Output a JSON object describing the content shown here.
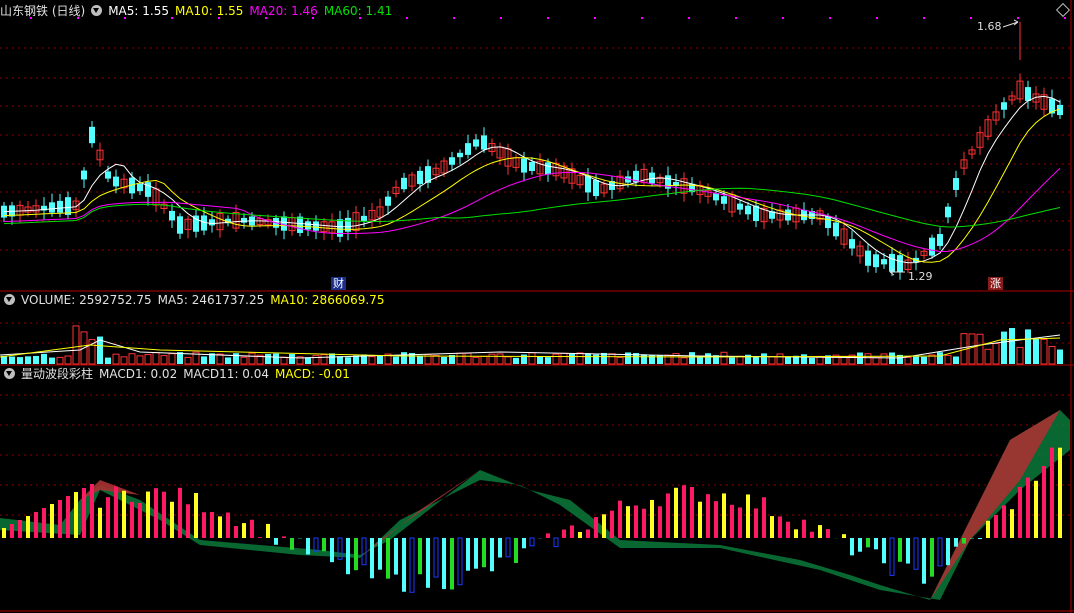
{
  "title": "山东钢铁 (日线)",
  "ma": {
    "ma5": "MA5: 1.55",
    "ma10": "MA10: 1.55",
    "ma20": "MA20: 1.46",
    "ma60": "MA60: 1.41"
  },
  "high_label": "1.68",
  "low_label": "1.29",
  "event_tags": {
    "cai": "财",
    "zhang": "涨"
  },
  "volume": {
    "volume": "VOLUME: 2592752.75",
    "ma5": "MA5: 2461737.25",
    "ma10": "MA10: 2866069.75"
  },
  "indicator": {
    "name": "量动波段彩柱",
    "macd1": "MACD1: 0.02",
    "macd11": "MACD11: 0.04",
    "macd": "MACD: -0.01"
  },
  "colors": {
    "up": "#ff3232",
    "down": "#54ffff",
    "ma5": "#ffffff",
    "ma10": "#ffff00",
    "ma20": "#ff00ff",
    "ma60": "#00e000",
    "grid": "#8b0000",
    "pink": "#ff1a66",
    "yellow": "#ffff22",
    "green_bar": "#22dd22",
    "blue_bar": "#1a3cff",
    "band_green": "#0a7a3a",
    "band_red": "#a83232"
  },
  "icons": [
    "dropdown-circle-icon",
    "diamond-settings-icon"
  ]
}
